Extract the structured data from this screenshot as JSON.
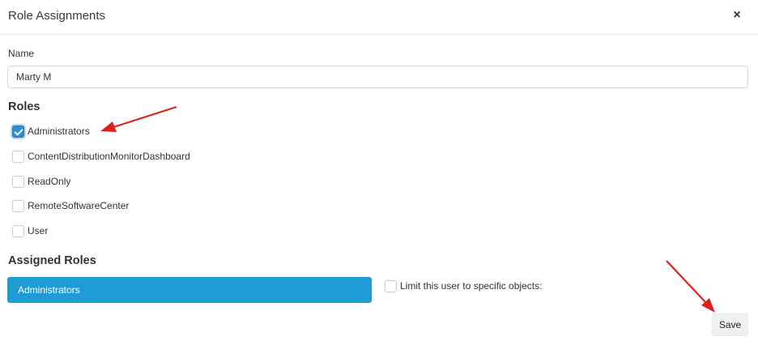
{
  "dialog": {
    "title": "Role Assignments",
    "close_label": "×"
  },
  "name_field": {
    "label": "Name",
    "value": "Marty M"
  },
  "roles": {
    "heading": "Roles",
    "items": [
      {
        "label": "Administrators",
        "checked": true
      },
      {
        "label": "ContentDistributionMonitorDashboard",
        "checked": false
      },
      {
        "label": "ReadOnly",
        "checked": false
      },
      {
        "label": "RemoteSoftwareCenter",
        "checked": false
      },
      {
        "label": "User",
        "checked": false
      }
    ]
  },
  "assigned_roles": {
    "heading": "Assigned Roles",
    "items": [
      "Administrators"
    ]
  },
  "limit_option": {
    "label": "Limit this user to specific objects:",
    "checked": false
  },
  "footer": {
    "save_label": "Save"
  },
  "colors": {
    "accent": "#1f9bd6",
    "annotation_arrow": "#e02020"
  }
}
